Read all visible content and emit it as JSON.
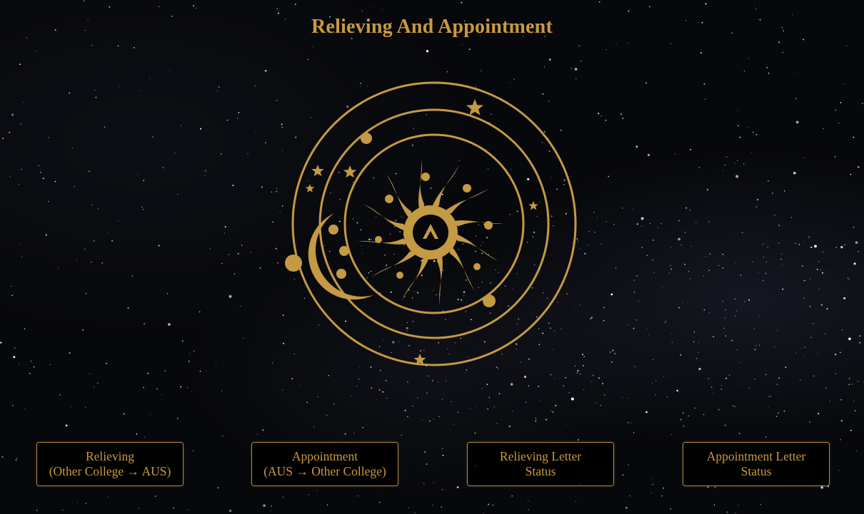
{
  "page": {
    "title": "Relieving And Appointment"
  },
  "colors": {
    "accent_gold": "#c99a3e",
    "button_border": "#b08a4a",
    "background": "#07080b"
  },
  "emblem": {
    "icon": "celestial-sun-orbit-logo",
    "center_letter": "A"
  },
  "buttons": [
    {
      "line1": "Relieving",
      "line2": "(Other College → AUS)"
    },
    {
      "line1": "Appointment",
      "line2": "(AUS → Other College)"
    },
    {
      "line1": "Relieving Letter",
      "line2": "Status"
    },
    {
      "line1": "Appointment Letter",
      "line2": "Status"
    }
  ]
}
